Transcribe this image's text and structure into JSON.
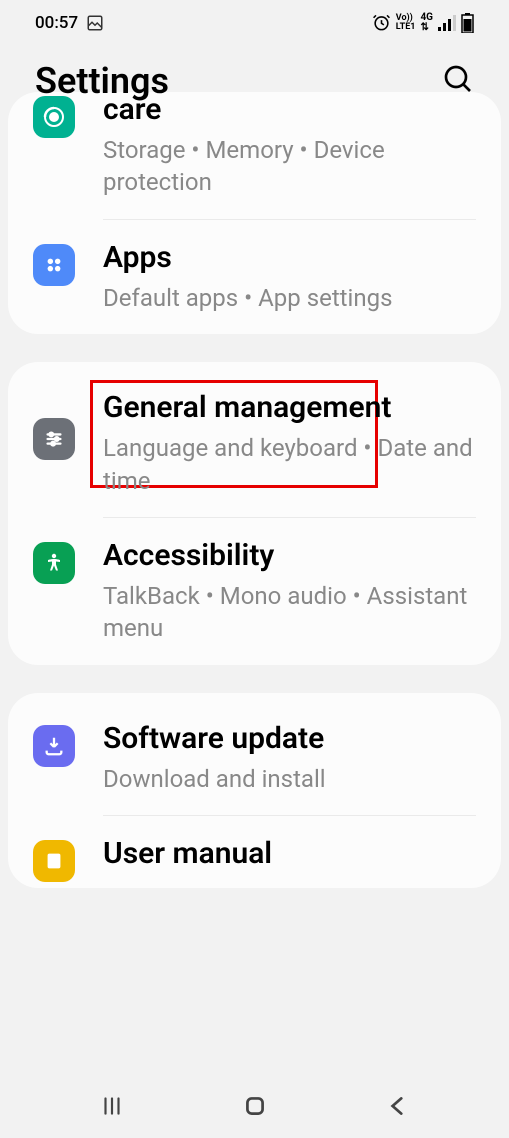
{
  "statusBar": {
    "time": "00:57"
  },
  "header": {
    "title": "Settings"
  },
  "items": {
    "care": {
      "title": "care",
      "subtitle": "Storage  •  Memory  •  Device protection"
    },
    "apps": {
      "title": "Apps",
      "subtitle": "Default apps  •  App settings"
    },
    "general": {
      "title": "General management",
      "subtitle": "Language and keyboard  •  Date and time"
    },
    "accessibility": {
      "title": "Accessibility",
      "subtitle": "TalkBack  •  Mono audio  •  Assistant menu"
    },
    "software": {
      "title": "Software update",
      "subtitle": "Download and install"
    },
    "manual": {
      "title": "User manual"
    }
  }
}
